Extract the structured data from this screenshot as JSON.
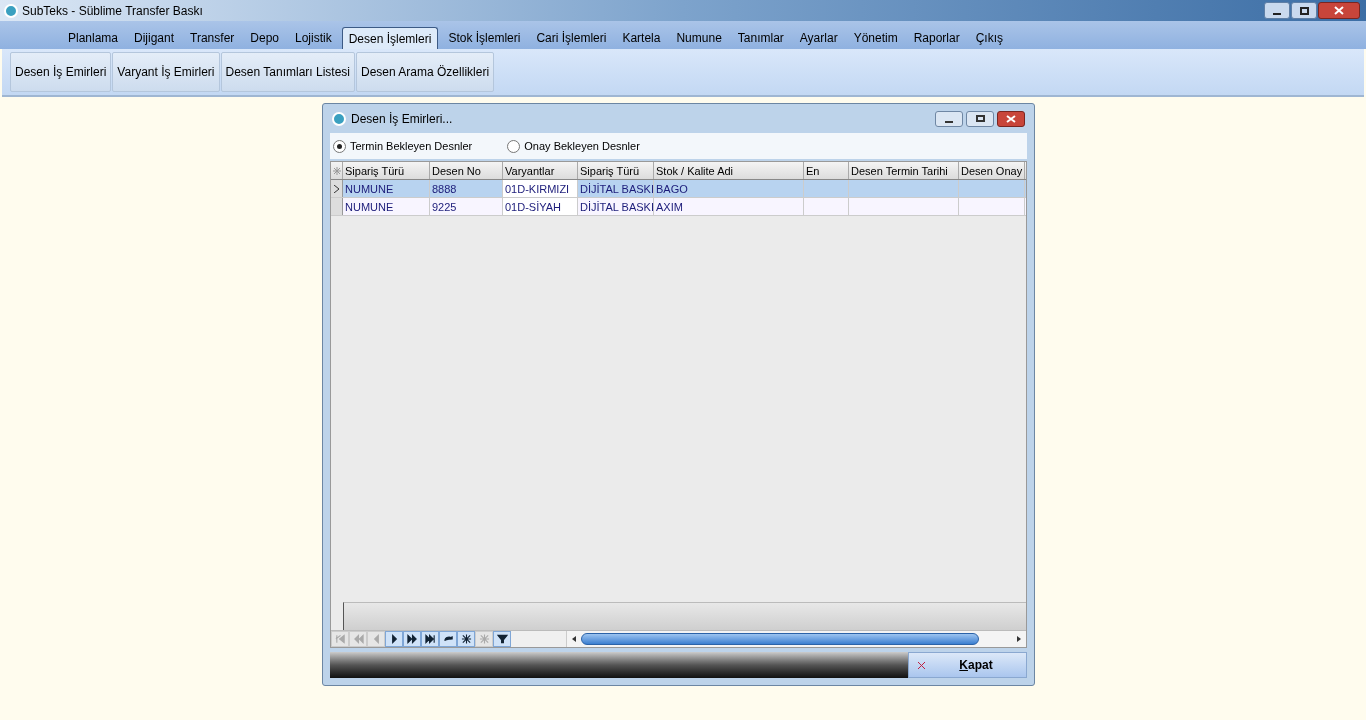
{
  "window": {
    "title": "SubTeks - Süblime Transfer Baskı"
  },
  "menu": [
    {
      "label": "Planlama",
      "selected": false
    },
    {
      "label": "Dijigant",
      "selected": false
    },
    {
      "label": "Transfer",
      "selected": false
    },
    {
      "label": "Depo",
      "selected": false
    },
    {
      "label": "Lojistik",
      "selected": false
    },
    {
      "label": "Desen İşlemleri",
      "selected": true
    },
    {
      "label": "Stok İşlemleri",
      "selected": false
    },
    {
      "label": "Cari İşlemleri",
      "selected": false
    },
    {
      "label": "Kartela",
      "selected": false
    },
    {
      "label": "Numune",
      "selected": false
    },
    {
      "label": "Tanımlar",
      "selected": false
    },
    {
      "label": "Ayarlar",
      "selected": false
    },
    {
      "label": "Yönetim",
      "selected": false
    },
    {
      "label": "Raporlar",
      "selected": false
    },
    {
      "label": "Çıkış",
      "selected": false
    }
  ],
  "ribbon": [
    "Desen İş Emirleri",
    "Varyant İş Emirleri",
    "Desen Tanımları Listesi",
    "Desen Arama Özellikleri"
  ],
  "dialog": {
    "title": "Desen İş Emirleri...",
    "radios": [
      {
        "label": "Termin Bekleyen Desnler",
        "selected": true
      },
      {
        "label": "Onay Bekleyen Desnler",
        "selected": false
      }
    ],
    "table": {
      "columns": [
        "Sipariş Türü",
        "Desen No",
        "Varyantlar",
        "Sipariş Türü",
        "Stok / Kalite Adi",
        "En",
        "Desen Termin Tarihi",
        "Desen Onay"
      ],
      "rows": [
        {
          "selected": true,
          "cells": [
            "NUMUNE",
            "8888",
            "01D-KIRMIZI",
            "DİJİTAL BASKI",
            "BAGO",
            "",
            "",
            ""
          ]
        },
        {
          "selected": false,
          "cells": [
            "NUMUNE",
            "9225",
            "01D-SİYAH",
            "DİJİTAL BASKI",
            "AXIM",
            "",
            "",
            ""
          ]
        }
      ]
    },
    "navigator": [
      {
        "kind": "first",
        "disabled": true
      },
      {
        "kind": "prev-page",
        "disabled": true
      },
      {
        "kind": "prev",
        "disabled": true
      },
      {
        "kind": "next",
        "disabled": false
      },
      {
        "kind": "next-page",
        "disabled": false
      },
      {
        "kind": "last",
        "disabled": false
      },
      {
        "kind": "refresh",
        "disabled": false
      },
      {
        "kind": "insert",
        "disabled": false
      },
      {
        "kind": "delete",
        "disabled": true
      },
      {
        "kind": "filter",
        "disabled": false
      }
    ],
    "close_button": "Kapat"
  }
}
